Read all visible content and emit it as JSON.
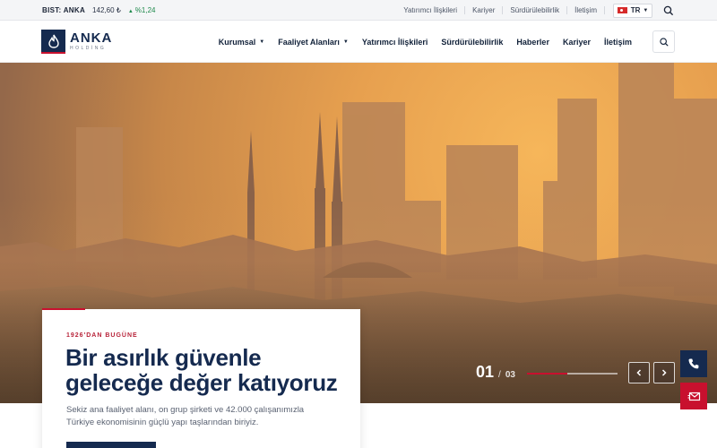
{
  "topbar": {
    "ticker_symbol": "BIST: ANKA",
    "ticker_price": "142,60 ₺",
    "ticker_change": "%1,24",
    "ticker_direction": "up",
    "links": [
      {
        "label": "Yatırımcı İlişkileri"
      },
      {
        "label": "Kariyer"
      },
      {
        "label": "Sürdürülebilirlik"
      },
      {
        "label": "İletişim"
      }
    ],
    "language": "TR",
    "search_icon": "search-icon"
  },
  "header": {
    "logo_name": "ANKA",
    "logo_sub": "HOLDİNG",
    "nav": [
      {
        "label": "Kurumsal",
        "has_dropdown": true
      },
      {
        "label": "Faaliyet Alanları",
        "has_dropdown": true
      },
      {
        "label": "Yatırımcı İlişkileri",
        "has_dropdown": false
      },
      {
        "label": "Sürdürülebilirlik",
        "has_dropdown": false
      },
      {
        "label": "Haberler",
        "has_dropdown": false
      },
      {
        "label": "Kariyer",
        "has_dropdown": false
      },
      {
        "label": "İletişim",
        "has_dropdown": false
      }
    ],
    "search_icon": "search-icon"
  },
  "hero": {
    "slide_current": "01",
    "slide_separator": "/",
    "slide_total": "03",
    "progress": 0.45,
    "eyebrow": "1926'DAN BUGÜNE",
    "headline": "Bir asırlık güvenle geleceğe değer katıyoruz",
    "lead": "Sekiz ana faaliyet alanı, on grup şirketi ve 42.000 çalışanımızla Türkiye ekonomisinin güçlü yapı taşlarından biriyiz."
  },
  "colors": {
    "brand_navy": "#152a4f",
    "brand_red": "#c8102e",
    "ticker_up": "#1f8a4c"
  },
  "side_actions": [
    {
      "icon": "phone-icon"
    },
    {
      "icon": "mail-icon"
    }
  ]
}
